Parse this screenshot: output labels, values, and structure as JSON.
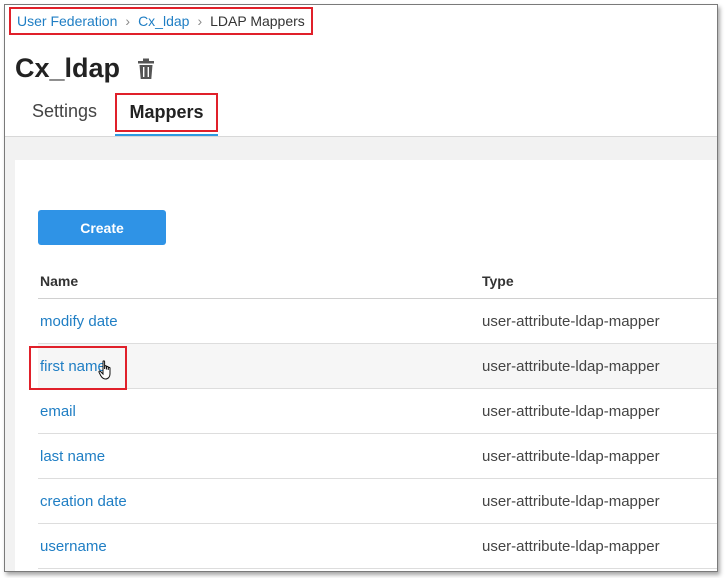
{
  "breadcrumb": {
    "items": [
      {
        "label": "User Federation"
      },
      {
        "label": "Cx_ldap"
      },
      {
        "label": "LDAP Mappers"
      }
    ]
  },
  "page": {
    "title": "Cx_ldap",
    "delete_icon": "trash-icon"
  },
  "tabs": [
    {
      "label": "Settings",
      "active": false
    },
    {
      "label": "Mappers",
      "active": true
    }
  ],
  "toolbar": {
    "create_label": "Create"
  },
  "table": {
    "columns": [
      "Name",
      "Type"
    ],
    "rows": [
      {
        "name": "modify date",
        "type": "user-attribute-ldap-mapper"
      },
      {
        "name": "first name",
        "type": "user-attribute-ldap-mapper"
      },
      {
        "name": "email",
        "type": "user-attribute-ldap-mapper"
      },
      {
        "name": "last name",
        "type": "user-attribute-ldap-mapper"
      },
      {
        "name": "creation date",
        "type": "user-attribute-ldap-mapper"
      },
      {
        "name": "username",
        "type": "user-attribute-ldap-mapper"
      }
    ]
  },
  "colors": {
    "link": "#1f7ec4",
    "primary": "#2f93e6",
    "annotation": "#e0202a"
  }
}
